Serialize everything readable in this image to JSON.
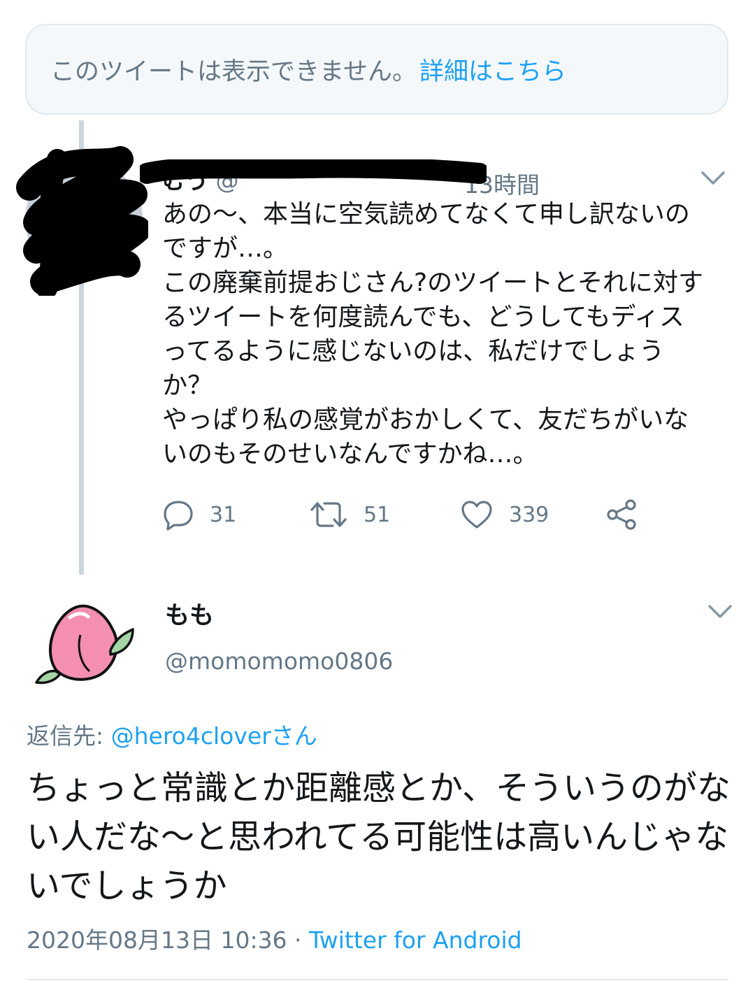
{
  "notice": {
    "text": "このツイートは表示できません。",
    "link": "詳細はこちら"
  },
  "parent_tweet": {
    "name": "むう",
    "handle": "@",
    "time": "13時間",
    "body": "あの〜、本当に空気読めてなくて申し訳ないの\nですが…。\nこの廃棄前提おじさん?のツイートとそれに対す\nるツイートを何度読んでも、どうしてもディス\nってるように感じないのは、私だけでしょう\nか？\nやっぱり私の感覚がおかしくて、友だちがいな\nいのもそのせいなんですかね…。",
    "reply_count": "31",
    "retweet_count": "51",
    "like_count": "339"
  },
  "main_tweet": {
    "name": "もも",
    "handle": "@momomomo0806",
    "reply_label": "返信先: ",
    "reply_target": "@hero4cloverさん",
    "body": "ちょっと常識とか距離感とか、そういうのがない人だな〜と思われてる可能性は高いんじゃないでしょうか",
    "timestamp": "2020年08月13日 10:36",
    "separator": " · ",
    "client": "Twitter for Android"
  },
  "colors": {
    "accent": "#1da1f2",
    "muted": "#657786",
    "text": "#14171a",
    "border": "#e1e8ed"
  },
  "icons": [
    "reply-icon",
    "retweet-icon",
    "like-icon",
    "share-icon",
    "chevron-down-icon",
    "peach-avatar"
  ]
}
